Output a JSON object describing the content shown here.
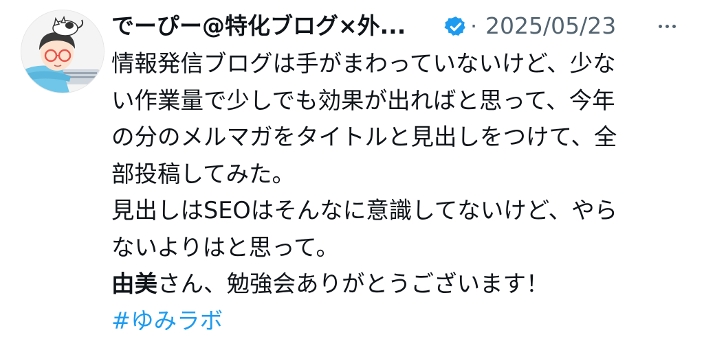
{
  "author": {
    "display_name": "でーぴー@特化ブログ×外...",
    "verified_icon": "verified-badge-icon",
    "avatar_icon": "avatar-illustration"
  },
  "meta": {
    "separator": "·",
    "timestamp": "2025/05/23",
    "more_icon": "more-options-icon"
  },
  "body": {
    "lines": [
      "情報発信ブログは手がまわっていないけど、少な",
      "い作業量で少しでも効果が出ればと思って、今年",
      "の分のメルマガをタイトルと見出しをつけて、全",
      "部投稿してみた。",
      "見出しはSEOはそんなに意識してないけど、やら",
      "ないよりはと思って。"
    ],
    "mention_bold": "由美",
    "mention_rest": "さん、勉強会ありがとうございます！",
    "hashtag": "#ゆみラボ"
  },
  "colors": {
    "text": "#0f1419",
    "muted": "#536471",
    "link": "#1d9bf0"
  }
}
